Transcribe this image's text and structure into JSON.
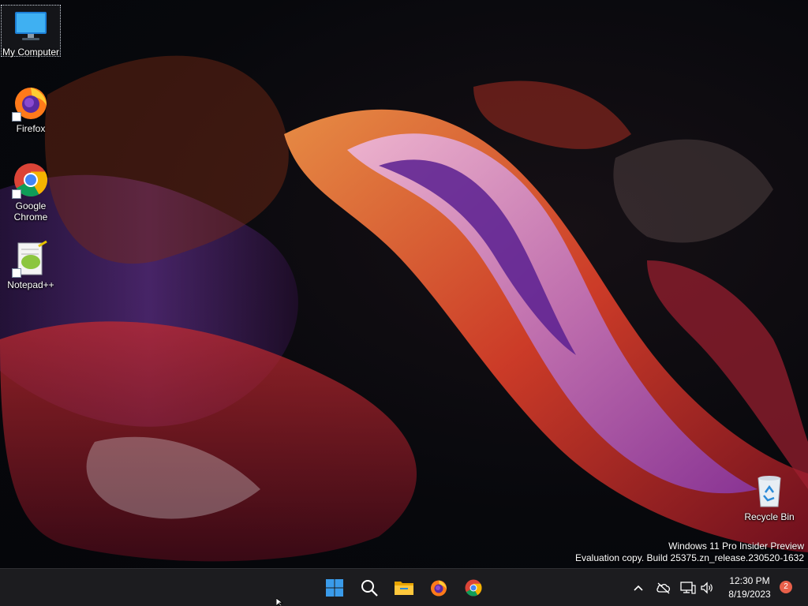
{
  "desktop": {
    "icons": [
      {
        "label": "My Computer",
        "icon": "monitor-icon"
      },
      {
        "label": "Firefox",
        "icon": "firefox-icon"
      },
      {
        "label": "Google Chrome",
        "icon": "chrome-icon"
      },
      {
        "label": "Notepad++",
        "icon": "notepadpp-icon"
      },
      {
        "label": "Recycle Bin",
        "icon": "recycle-bin-icon"
      }
    ],
    "watermark": {
      "line1": "Windows 11 Pro Insider Preview",
      "line2": "Evaluation copy. Build 25375.zn_release.230520-1632"
    }
  },
  "taskbar": {
    "pinned": [
      {
        "icon": "windows-start-icon"
      },
      {
        "icon": "search-icon"
      },
      {
        "icon": "file-explorer-icon"
      },
      {
        "icon": "firefox-icon"
      },
      {
        "icon": "chrome-icon"
      }
    ],
    "tray": [
      {
        "icon": "chevron-up-icon"
      },
      {
        "icon": "cloud-offline-icon"
      },
      {
        "icon": "network-icon"
      },
      {
        "icon": "volume-icon"
      }
    ],
    "clock": {
      "time": "12:30 PM",
      "date": "8/19/2023"
    },
    "notification_count": "2"
  },
  "colors": {
    "taskbar_bg": "#1c1c1f",
    "start_blue": "#3a9bea",
    "badge": "#e8604a"
  }
}
